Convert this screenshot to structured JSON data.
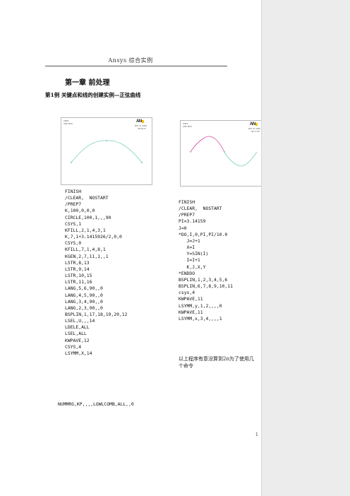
{
  "document": {
    "header": "Ansys 综合实例",
    "chapter": "第一章   前处理",
    "example_title": "第1例 关键点和线的创建实例—正弦曲线",
    "page_number": "1",
    "note": "以上程序有意没算到2π为了使用几个命令"
  },
  "figure1": {
    "logo": "AN",
    "label_top_left": "LINES",
    "label_top_left_2": "LINE NUM",
    "label_top_right": "MAY 31 2006",
    "label_top_right_2": "09:06:23"
  },
  "figure2": {
    "logo": "AN",
    "label_top_left": "LINES",
    "label_top_left_2": "LINE NUM",
    "label_top_right": "MAY 31 2006",
    "label_top_right_2": "09:17:58"
  },
  "code_left": "FINISH\n/CLEAR,  NOSTART\n/PREP7\nK,100,0,0,0\nCIRCLE,100,1,,,90\nCSYS,1\nKFILL,2,1,4,3,1\nK,7,1+3.1415926/2,0,0\nCSYS,0\nKFILL,7,1,4,8,1\nKGEN,2,7,11,1,,1\nLSTR,8,13\nLSTR,9,14\nLSTR,10,15\nLSTR,11,16\nLANG,5,6,90,,0\nLANG,4,5,90,,0\nLANG,3,4,90,,0\nLANG,2,3,90,,0\nBSPLIN,1,17,18,19,20,12\nLSEL,U,,,14\nLDELE,ALL\nLSEL,ALL\nKWPAVE,12\nCSYS,4\nLSYMM,X,14",
  "code_left_last": "NUMMRG,KP,,,,LOWLCOMB,ALL,,0",
  "code_right": "FINISH\n/CLEAR,  NOSTART\n/PREP7\nPI=3.14159\nJ=0\n*DO,I,0,PI,PI/10.0\n   J=J+1\n   X=I\n   Y=SIN(I)\n   I=I+1\n   K,J,X,Y\n*ENDDO\nBSPLIN,1,2,3,4,5,6\nBSPLIN,6,7,8,9,10,11\ncsys,4\nKWPAVE,11\nLSYMM,y,1,2,,,,0\nKWPAVE,11\nLSYMM,x,3,4,,,,1"
}
